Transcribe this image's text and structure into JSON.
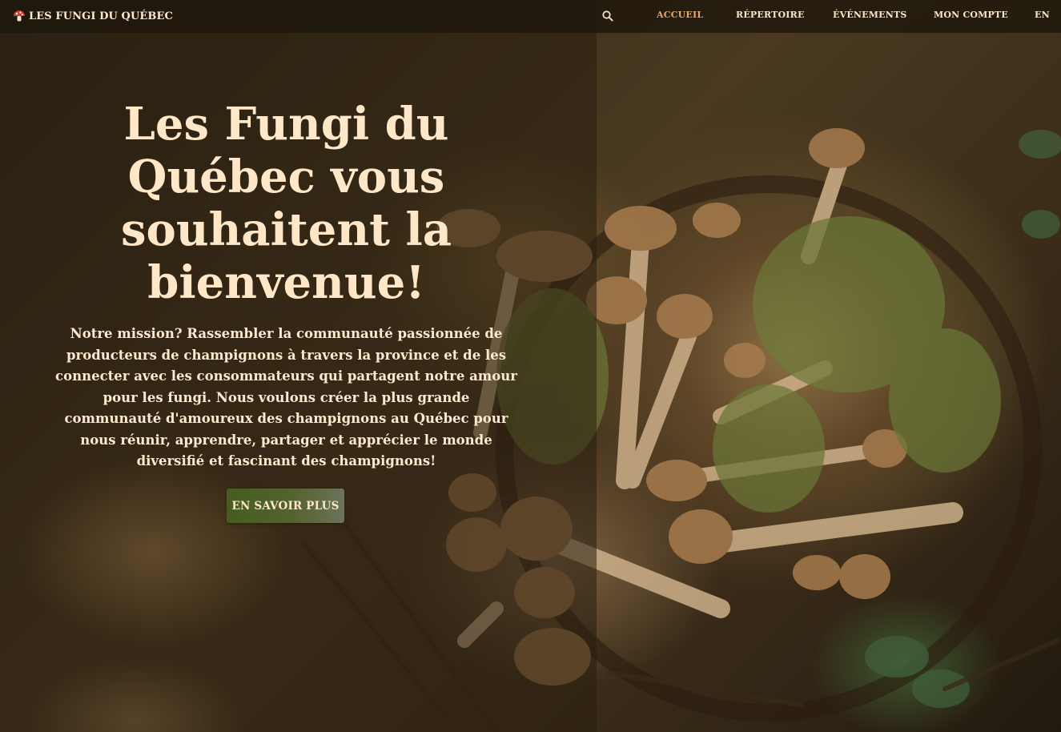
{
  "brand": {
    "icon": "mushroom-icon",
    "name": "LES FUNGI DU QUÉBEC"
  },
  "nav": {
    "search_icon": "search-icon",
    "items": [
      {
        "label": "ACCUEIL",
        "active": true
      },
      {
        "label": "RÉPERTOIRE",
        "active": false
      },
      {
        "label": "ÉVÉNEMENTS",
        "active": false
      },
      {
        "label": "MON COMPTE",
        "active": false
      },
      {
        "label": "EN",
        "active": false
      }
    ]
  },
  "hero": {
    "title": "Les Fungi du Québec vous souhaitent la bienvenue!",
    "mission": "Notre mission? Rassembler la communauté passionnée de producteurs de champignons à travers la province et de les connecter avec les consommateurs qui partagent notre amour pour les fungi. Nous voulons créer la plus grande communauté d'amoureux des champignons au Québec pour nous réunir, apprendre, partager et apprécier le monde diversifié et fascinant des champignons!",
    "cta_label": "EN SAVOIR PLUS"
  },
  "colors": {
    "accent_active_nav": "#e9a865",
    "title_text": "#ffe7c8",
    "cta_green": "#445e1f"
  }
}
